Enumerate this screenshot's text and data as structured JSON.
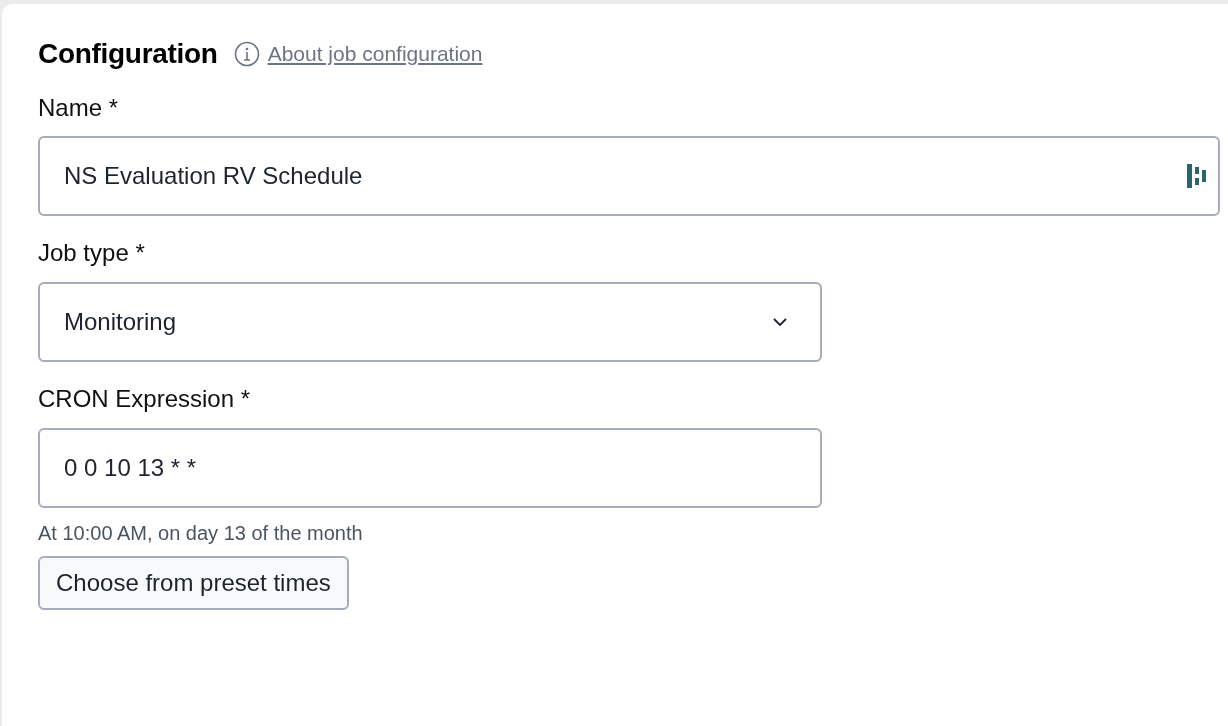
{
  "section": {
    "title": "Configuration",
    "help_link": "About job configuration"
  },
  "fields": [
    {
      "kind": "text",
      "label": "Name *",
      "value": "NS Evaluation RV Schedule",
      "wide": true,
      "trailing_icon": true
    },
    {
      "kind": "select",
      "label": "Job type *",
      "value": "Monitoring",
      "wide": false
    },
    {
      "kind": "text",
      "label": "CRON Expression *",
      "value": "0 0 10 13 * *",
      "wide": false,
      "help": "At 10:00 AM, on day 13 of the month",
      "button": "Choose from preset times"
    }
  ]
}
